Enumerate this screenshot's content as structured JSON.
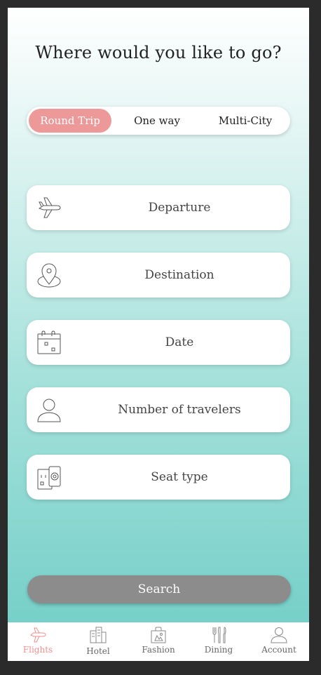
{
  "heading": "Where would you like to go?",
  "trip_types": [
    "Round Trip",
    "One way",
    "Multi-City"
  ],
  "selected_trip": "Round Trip",
  "fields": [
    {
      "label": "Departure",
      "icon": "airplane-icon"
    },
    {
      "label": "Destination",
      "icon": "location-pin-icon"
    },
    {
      "label": "Date",
      "icon": "calendar-icon"
    },
    {
      "label": "Number of travelers",
      "icon": "person-icon"
    },
    {
      "label": "Seat type",
      "icon": "ticket-icon"
    }
  ],
  "search_label": "Search",
  "tabs": [
    {
      "label": "Flights",
      "icon": "airplane-icon",
      "active": true
    },
    {
      "label": "Hotel",
      "icon": "building-icon",
      "active": false
    },
    {
      "label": "Fashion",
      "icon": "shopping-bag-icon",
      "active": false
    },
    {
      "label": "Dining",
      "icon": "fork-knife-icon",
      "active": false
    },
    {
      "label": "Account",
      "icon": "person-icon",
      "active": false
    }
  ],
  "colors": {
    "accent": "#ee9999",
    "teal_bottom": "#6fcdc6",
    "button_gray": "#8c8c8c"
  }
}
